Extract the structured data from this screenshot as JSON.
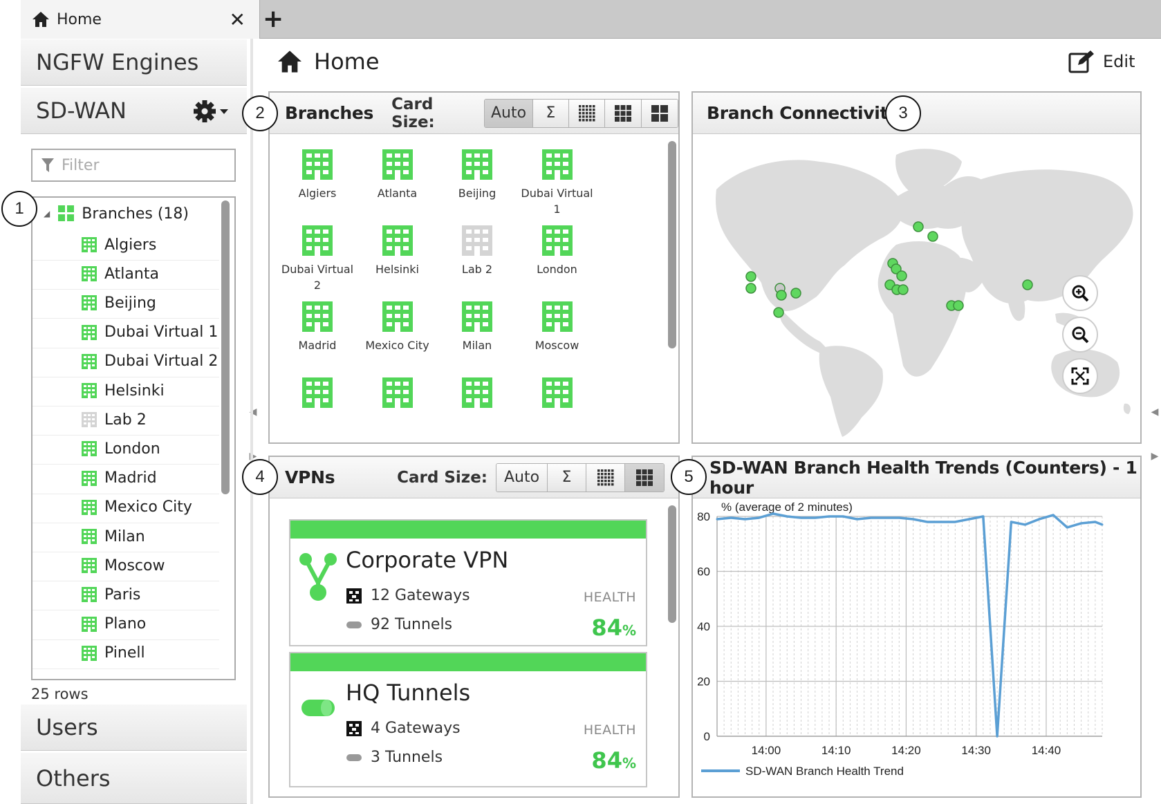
{
  "tab": {
    "label": "Home",
    "close_glyph": "✕",
    "add_glyph": "+"
  },
  "sidebar": {
    "sections": {
      "ngfw": "NGFW Engines",
      "sdwan": "SD-WAN",
      "users": "Users",
      "others": "Others"
    },
    "filter_placeholder": "Filter",
    "tree_root": "Branches (18)",
    "items": [
      {
        "label": "Algiers",
        "status": "ok"
      },
      {
        "label": "Atlanta",
        "status": "ok"
      },
      {
        "label": "Beijing",
        "status": "ok"
      },
      {
        "label": "Dubai Virtual 1",
        "status": "ok"
      },
      {
        "label": "Dubai Virtual 2",
        "status": "ok"
      },
      {
        "label": "Helsinki",
        "status": "ok"
      },
      {
        "label": "Lab 2",
        "status": "unknown"
      },
      {
        "label": "London",
        "status": "ok"
      },
      {
        "label": "Madrid",
        "status": "ok"
      },
      {
        "label": "Mexico City",
        "status": "ok"
      },
      {
        "label": "Milan",
        "status": "ok"
      },
      {
        "label": "Moscow",
        "status": "ok"
      },
      {
        "label": "Paris",
        "status": "ok"
      },
      {
        "label": "Plano",
        "status": "ok"
      },
      {
        "label": "Pinell",
        "status": "ok"
      }
    ],
    "rows_count": "25 rows"
  },
  "main": {
    "title": "Home",
    "edit_label": "Edit"
  },
  "branches_panel": {
    "title": "Branches",
    "card_size_label": "Card Size:",
    "size_auto": "Auto",
    "size_sum": "Σ",
    "cards": [
      {
        "label": "Algiers",
        "status": "ok"
      },
      {
        "label": "Atlanta",
        "status": "ok"
      },
      {
        "label": "Beijing",
        "status": "ok"
      },
      {
        "label": "Dubai Virtual 1",
        "status": "ok"
      },
      {
        "label": "Dubai Virtual 2",
        "status": "ok"
      },
      {
        "label": "Helsinki",
        "status": "ok"
      },
      {
        "label": "Lab 2",
        "status": "unknown"
      },
      {
        "label": "London",
        "status": "ok"
      },
      {
        "label": "Madrid",
        "status": "ok"
      },
      {
        "label": "Mexico City",
        "status": "ok"
      },
      {
        "label": "Milan",
        "status": "ok"
      },
      {
        "label": "Moscow",
        "status": "ok"
      },
      {
        "label": "",
        "status": "ok"
      },
      {
        "label": "",
        "status": "ok"
      },
      {
        "label": "",
        "status": "ok"
      },
      {
        "label": "",
        "status": "ok"
      }
    ]
  },
  "connectivity_panel": {
    "title": "Branch Connectivity"
  },
  "vpns_panel": {
    "title": "VPNs",
    "card_size_label": "Card Size:",
    "size_auto": "Auto",
    "size_sum": "Σ",
    "vpns": [
      {
        "name": "Corporate VPN",
        "gateways": "12 Gateways",
        "tunnels": "92 Tunnels",
        "health_label": "HEALTH",
        "health_value": "84",
        "health_unit": "%",
        "icon": "vpn-topology-icon"
      },
      {
        "name": "HQ Tunnels",
        "gateways": "4 Gateways",
        "tunnels": "3 Tunnels",
        "health_label": "HEALTH",
        "health_value": "84",
        "health_unit": "%",
        "icon": "tunnel-icon"
      }
    ]
  },
  "health_panel": {
    "title": "SD-WAN Branch Health Trends (Counters) - 1 hour"
  },
  "callouts": [
    "1",
    "2",
    "3",
    "4",
    "5"
  ],
  "colors": {
    "accent_green": "#52d658",
    "unknown_gray": "#d4d4d4",
    "line_blue": "#5b9fd4"
  },
  "chart_data": {
    "type": "line",
    "title": "",
    "ylabel": "% (average of 2 minutes)",
    "xlabel": "",
    "ylim": [
      0,
      80
    ],
    "yticks": [
      0,
      20,
      40,
      60,
      80
    ],
    "xticks": [
      "14:00",
      "14:10",
      "14:20",
      "14:30",
      "14:40"
    ],
    "xrange": [
      "13:53",
      "14:48"
    ],
    "grid": true,
    "legend": "bottom-left",
    "series": [
      {
        "name": "SD-WAN Branch Health Trend",
        "color": "#5b9fd4",
        "x": [
          "13:53",
          "13:55",
          "13:57",
          "13:59",
          "14:01",
          "14:03",
          "14:05",
          "14:07",
          "14:09",
          "14:11",
          "14:13",
          "14:15",
          "14:17",
          "14:19",
          "14:21",
          "14:23",
          "14:25",
          "14:27",
          "14:29",
          "14:31",
          "14:33",
          "14:35",
          "14:37",
          "14:39",
          "14:41",
          "14:43",
          "14:45",
          "14:47",
          "14:48"
        ],
        "y": [
          79,
          79.5,
          79,
          79.5,
          81,
          80,
          79.5,
          79.5,
          80,
          80,
          79,
          79.5,
          79.5,
          79.5,
          79,
          78,
          78,
          78,
          79,
          80,
          0,
          78,
          77,
          79,
          80.5,
          76,
          77.5,
          78,
          77
        ]
      }
    ]
  }
}
